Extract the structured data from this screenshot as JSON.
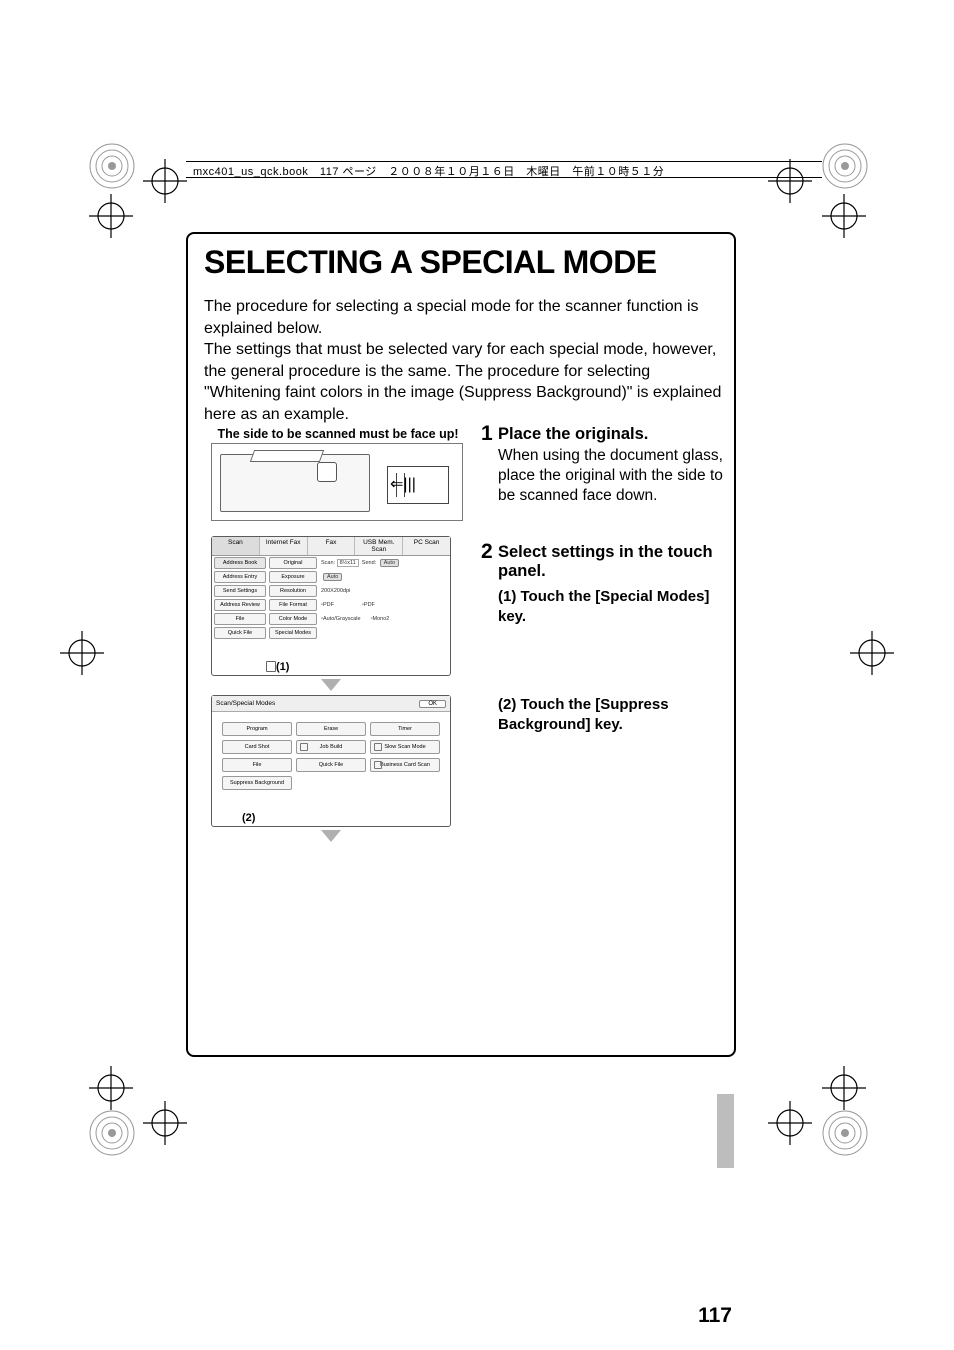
{
  "header_line": "mxc401_us_qck.book　117 ページ　２００８年１０月１６日　木曜日　午前１０時５１分",
  "title": "SELECTING A SPECIAL MODE",
  "intro": "The procedure for selecting a special mode for the scanner function is explained below.\nThe settings that must be selected vary for each special mode, however, the general procedure is the same. The procedure for selecting \"Whitening faint colors in the image (Suppress Background)\" is explained here as an example.",
  "faceup_caption": "The side to be scanned must be face up!",
  "step1": {
    "num": "1",
    "title": "Place the originals.",
    "body": "When using the document glass, place the original with the side to be scanned face down."
  },
  "step2": {
    "num": "2",
    "title": "Select settings in the touch panel.",
    "sub1": "(1) Touch the [Special Modes] key.",
    "sub2": "(2) Touch the [Suppress Background] key."
  },
  "panel1": {
    "tabs": [
      "Scan",
      "Internet Fax",
      "Fax",
      "USB Mem. Scan",
      "PC Scan"
    ],
    "sidebar": [
      "Address Book",
      "Address Entry",
      "Send Settings",
      "Address Review",
      "File",
      "Quick File"
    ],
    "rows": [
      {
        "label": "Original",
        "mid": "Scan:",
        "val": "8½x11",
        "right": "Send:",
        "badge": "Auto"
      },
      {
        "label": "Exposure",
        "val": "Auto"
      },
      {
        "label": "Resolution",
        "val": "200X200dpi"
      },
      {
        "label": "File Format",
        "val": "PDF",
        "val2": "PDF"
      },
      {
        "label": "Color Mode",
        "val": "Auto/Grayscale",
        "val2": "Mono2"
      },
      {
        "label": "Special Modes",
        "val": ""
      }
    ],
    "callout": "(1)"
  },
  "panel2": {
    "title": "Scan/Special Modes",
    "ok": "OK",
    "buttons": [
      "Program",
      "Erase",
      "Timer",
      "Card Shot",
      "Job Build",
      "Slow Scan Mode",
      "File",
      "Quick File",
      "Business Card Scan",
      "Suppress Background"
    ],
    "callout": "(2)"
  },
  "page_number": "117"
}
